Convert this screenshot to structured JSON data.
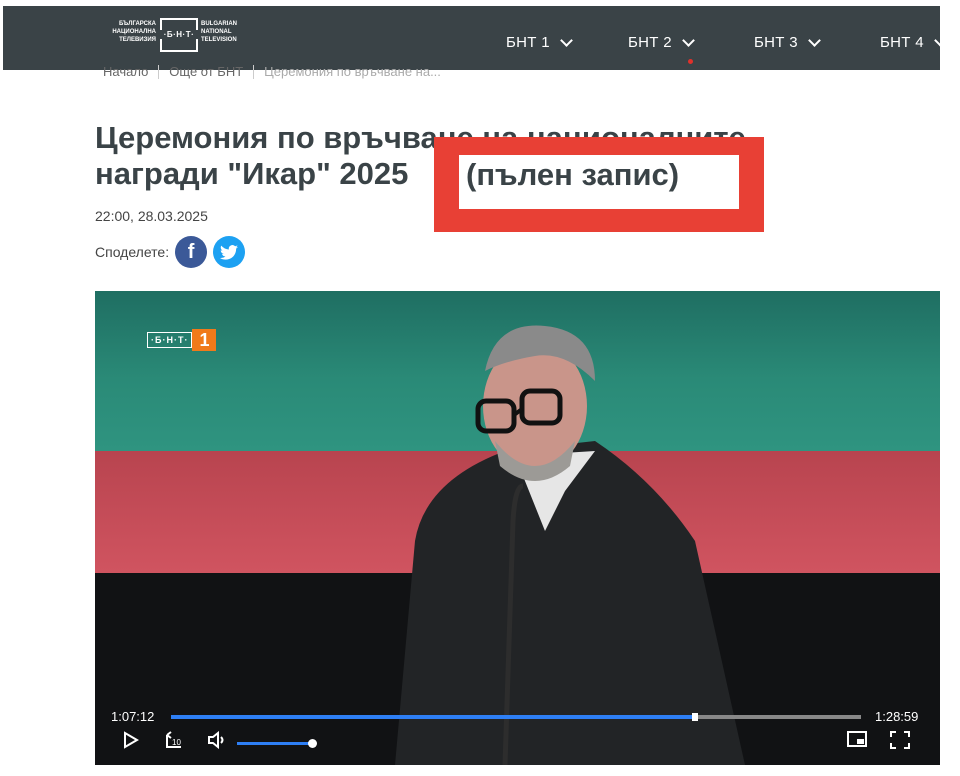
{
  "header": {
    "logo_left": "БЪЛГАРСКА НАЦИОНАЛНА ТЕЛЕВИЗИЯ",
    "logo_mark": "·Б·Н·Т·",
    "logo_right": "BULGARIAN NATIONAL TELEVISION",
    "nav": [
      "БНТ 1",
      "БНТ 2",
      "БНТ 3",
      "БНТ 4"
    ]
  },
  "breadcrumb": {
    "home": "Начало",
    "section": "Още от БНТ",
    "current": "Церемония по връчване на..."
  },
  "article": {
    "title": "Церемония по връчване на националните награди \"Икар\" 2025",
    "highlight": "(пълен запис)",
    "datetime": "22:00, 28.03.2025",
    "share_label": "Споделете:"
  },
  "video": {
    "channel_logo_text": "·Б·Н·Т·",
    "channel_number": "1",
    "current_time": "1:07:12",
    "duration": "1:28:59",
    "progress_fraction": 0.755,
    "volume_fraction": 1.0
  },
  "colors": {
    "header_bg": "#3a4347",
    "highlight_red": "#e84035",
    "progress_blue": "#2e7ff5",
    "facebook": "#3b5998",
    "twitter": "#1da1f2"
  },
  "icons": [
    "facebook-icon",
    "twitter-icon",
    "play-icon",
    "rewind-10-icon",
    "volume-icon",
    "pip-icon",
    "fullscreen-icon"
  ]
}
